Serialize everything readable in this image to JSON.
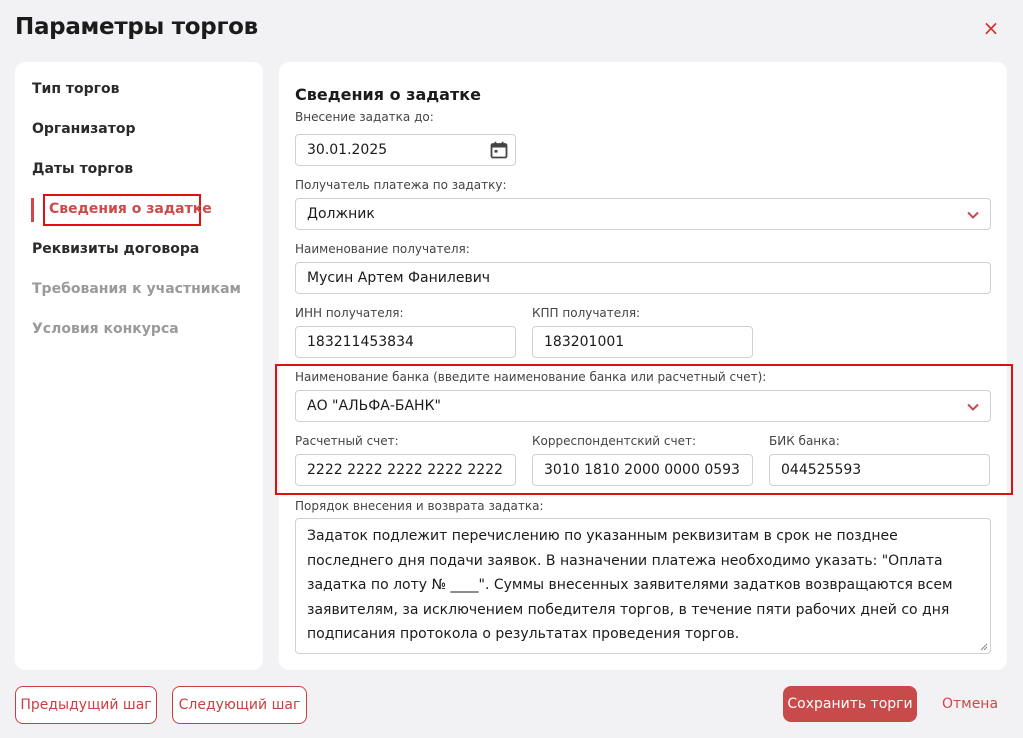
{
  "dialog": {
    "title": "Параметры торгов",
    "close_icon": "×"
  },
  "sidebar": {
    "items": [
      {
        "label": "Тип торгов",
        "state": "normal"
      },
      {
        "label": "Организатор",
        "state": "normal"
      },
      {
        "label": "Даты торгов",
        "state": "normal"
      },
      {
        "label": "Сведения о задатке",
        "state": "active"
      },
      {
        "label": "Реквизиты договора",
        "state": "normal"
      },
      {
        "label": "Требования к участникам",
        "state": "disabled"
      },
      {
        "label": "Условия конкурса",
        "state": "disabled"
      }
    ]
  },
  "form": {
    "section_title": "Сведения о задатке",
    "deposit_due": {
      "label": "Внесение задатка до:",
      "value": "30.01.2025"
    },
    "payee_type": {
      "label": "Получатель платежа по задатку:",
      "value": "Должник"
    },
    "payee_name": {
      "label": "Наименование получателя:",
      "value": "Мусин Артем Фанилевич"
    },
    "inn": {
      "label": "ИНН получателя:",
      "value": "183211453834"
    },
    "kpp": {
      "label": "КПП получателя:",
      "value": "183201001"
    },
    "bank_name": {
      "label": "Наименование банка (введите наименование банка или расчетный счет):",
      "value": "АО \"АЛЬФА-БАНК\""
    },
    "account": {
      "label": "Расчетный счет:",
      "value": "2222 2222 2222 2222 2222"
    },
    "corr_account": {
      "label": "Корреспондентский счет:",
      "value": "3010 1810 2000 0000 0593"
    },
    "bik": {
      "label": "БИК банка:",
      "value": "044525593"
    },
    "procedure": {
      "label": "Порядок внесения и возврата задатка:",
      "value": "Задаток подлежит перечислению по указанным реквизитам в срок не позднее последнего дня подачи заявок. В назначении платежа необходимо указать: \"Оплата задатка по лоту № ____\". Суммы внесенных заявителями задатков возвращаются всем заявителям, за исключением победителя торгов, в течение пяти рабочих дней со дня подписания протокола о результатах проведения торгов."
    }
  },
  "footer": {
    "prev_label": "Предыдущий шаг",
    "next_label": "Следующий шаг",
    "save_label": "Сохранить торги",
    "cancel_label": "Отмена"
  },
  "colors": {
    "accent": "#c94a4a",
    "highlight": "#e01010",
    "background": "#f2f2f4"
  }
}
